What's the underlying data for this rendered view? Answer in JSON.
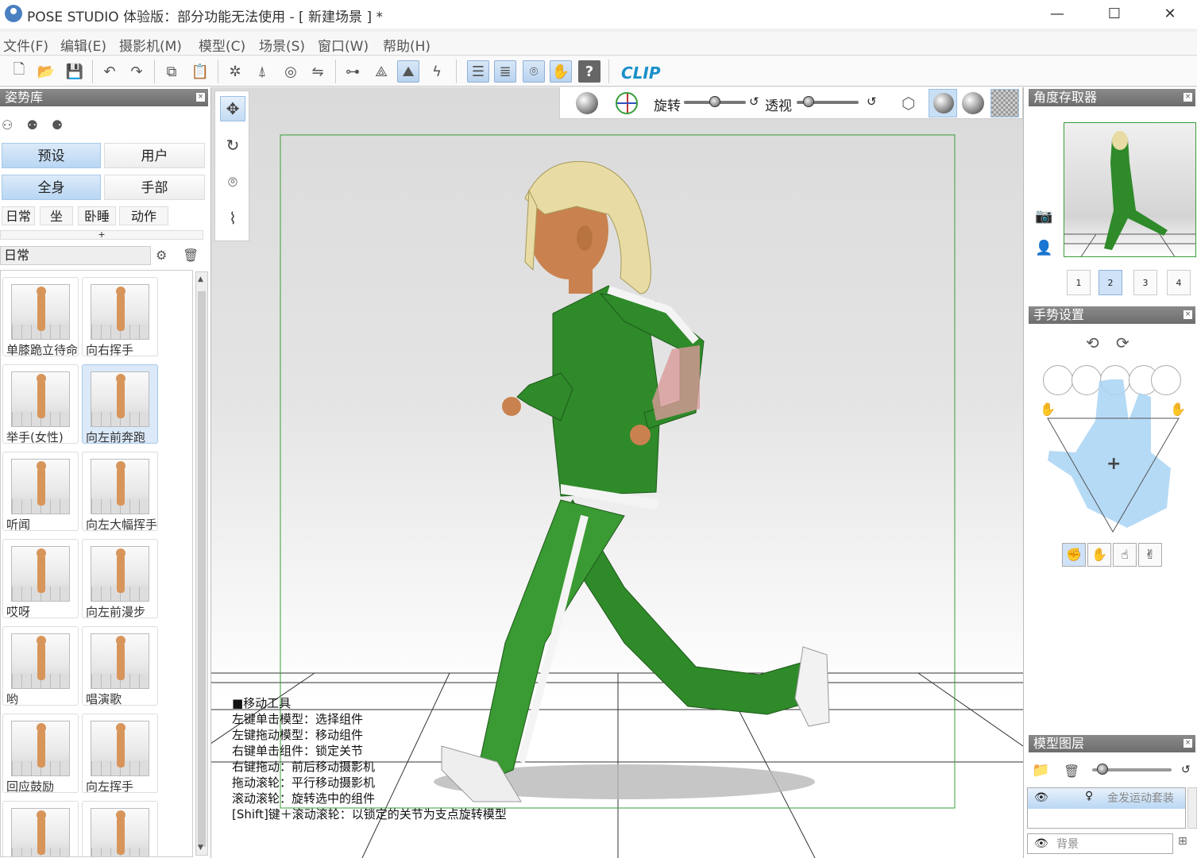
{
  "window": {
    "title": "POSE STUDIO 体验版：部分功能无法使用 - [  新建场景  ] *",
    "minimize": "—",
    "maximize": "☐",
    "close": "✕"
  },
  "menu": [
    "文件(F)",
    "编辑(E)",
    "摄影机(M)",
    "模型(C)",
    "场景(S)",
    "窗口(W)",
    "帮助(H)"
  ],
  "toolbar": {
    "logo": "CLIP",
    "help": "?"
  },
  "pose_library": {
    "title": "姿势库",
    "close": "×",
    "source_tabs": [
      {
        "label": "预设",
        "active": true
      },
      {
        "label": "用户",
        "active": false
      }
    ],
    "part_tabs": [
      {
        "label": "全身",
        "active": true
      },
      {
        "label": "手部",
        "active": false
      }
    ],
    "category_tabs": [
      "日常",
      "坐",
      "卧睡",
      "动作"
    ],
    "add_label": "+",
    "current_category": "日常",
    "poses": [
      {
        "label": "单膝跪立待命"
      },
      {
        "label": "向右挥手"
      },
      {
        "label": "举手(女性)"
      },
      {
        "label": "向左前奔跑",
        "selected": true
      },
      {
        "label": "听闻"
      },
      {
        "label": "向左大幅挥手"
      },
      {
        "label": "哎呀"
      },
      {
        "label": "向左前漫步"
      },
      {
        "label": "哟"
      },
      {
        "label": "唱演歌"
      },
      {
        "label": "回应鼓励"
      },
      {
        "label": "向左挥手"
      },
      {
        "label": ""
      },
      {
        "label": ""
      }
    ]
  },
  "viewport": {
    "rotate_label": "旋转",
    "perspective_label": "透视",
    "reset_symbol": "↺",
    "help_lines": [
      "■移动工具",
      "左键单击模型：选择组件",
      "左键拖动模型：移动组件",
      "右键单击组件：锁定关节",
      "右键拖动：前后移动摄影机",
      "拖动滚轮：平行移动摄影机",
      "滚动滚轮：旋转选中的组件",
      "[Shift]键＋滚动滚轮：以锁定的关节为支点旋转模型"
    ]
  },
  "camera_store": {
    "title": "角度存取器",
    "close": "×",
    "slots": [
      "1",
      "2",
      "3",
      "4"
    ],
    "active_slot": "2"
  },
  "hand_settings": {
    "title": "手势设置",
    "close": "×",
    "center_marker": "+"
  },
  "model_layers": {
    "title": "模型图层",
    "close": "×",
    "layers": [
      {
        "name": "金发运动套装",
        "visible": true,
        "selected": true
      },
      {
        "name": "背景",
        "visible": true,
        "selected": false
      }
    ]
  },
  "colors": {
    "accent": "#b9d6f3",
    "panel_header": "#777777",
    "suit_green": "#2f8a2a",
    "selection_frame": "#3a9d3a"
  }
}
